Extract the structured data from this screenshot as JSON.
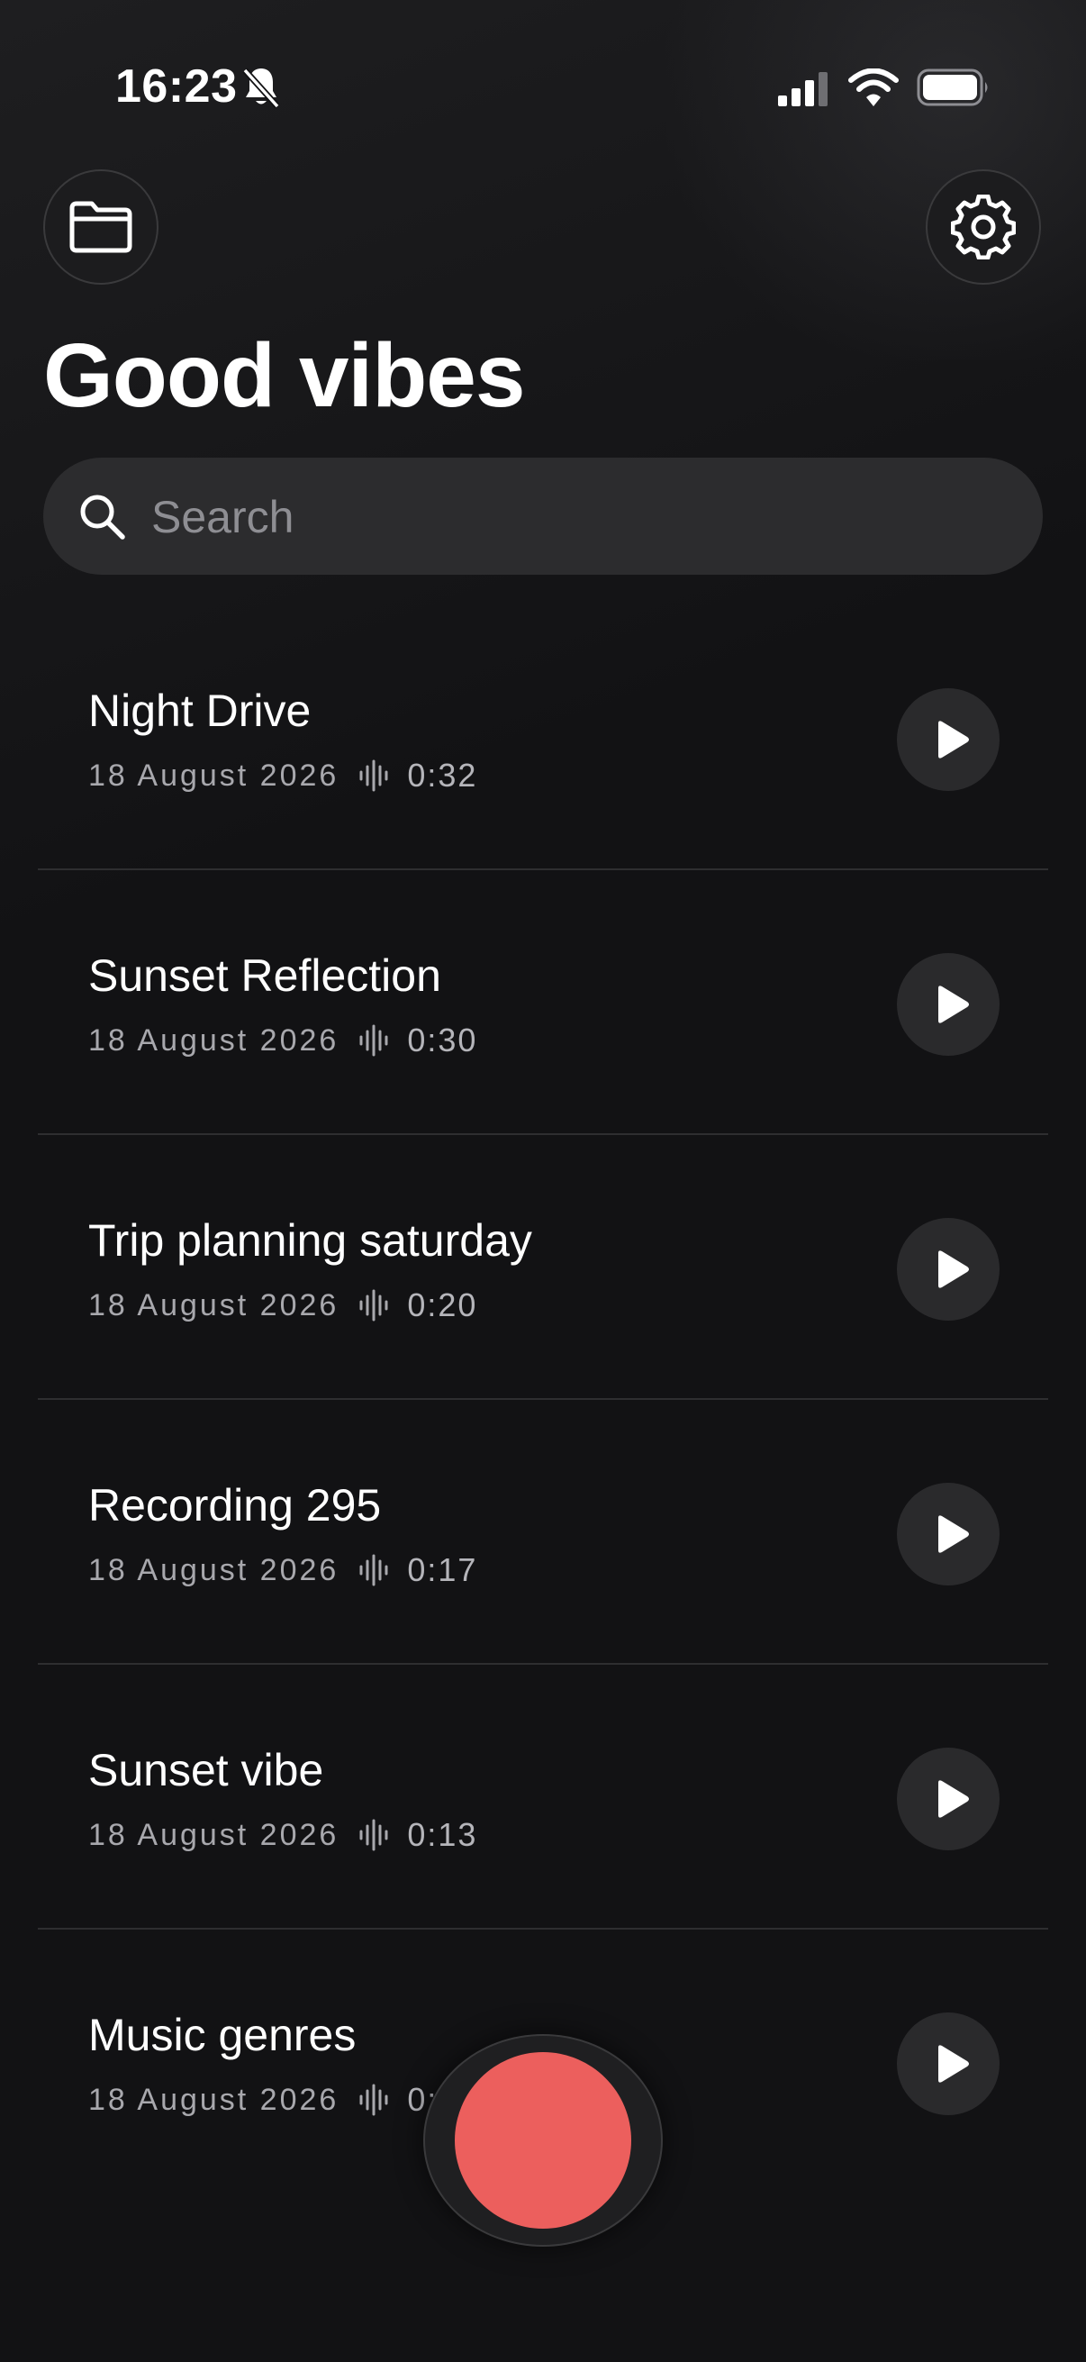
{
  "status_bar": {
    "time": "16:23",
    "icons": [
      "bell-muted-icon",
      "cellular-signal-icon",
      "wifi-icon",
      "battery-icon"
    ]
  },
  "header": {
    "left_button_icon": "folder-icon",
    "right_button_icon": "gear-icon",
    "title": "Good vibes"
  },
  "search": {
    "icon": "search-icon",
    "placeholder": "Search",
    "value": ""
  },
  "recordings": [
    {
      "title": "Night Drive",
      "date": "18 August 2026",
      "duration": "0:32"
    },
    {
      "title": "Sunset Reflection",
      "date": "18 August 2026",
      "duration": "0:30"
    },
    {
      "title": "Trip planning saturday",
      "date": "18 August 2026",
      "duration": "0:20"
    },
    {
      "title": "Recording 295",
      "date": "18 August 2026",
      "duration": "0:17"
    },
    {
      "title": "Sunset vibe",
      "date": "18 August 2026",
      "duration": "0:13"
    },
    {
      "title": "Music genres",
      "date": "18 August 2026",
      "duration": "0:"
    }
  ],
  "record_button": {
    "icon": "record-icon",
    "color": "#ec5f5d"
  },
  "colors": {
    "background": "#121214",
    "accent_record": "#ec5f5d",
    "surface": "#2c2c2e",
    "secondary_text": "#a8a8ad"
  }
}
